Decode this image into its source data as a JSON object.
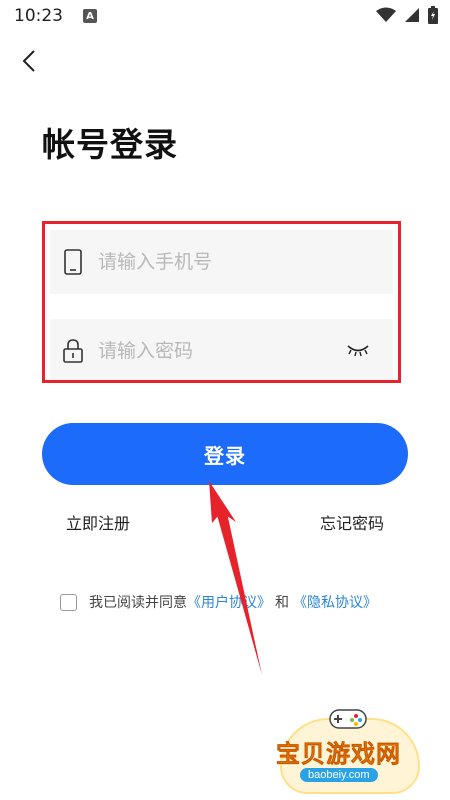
{
  "status_bar": {
    "time": "10:23",
    "notification_letter": "A"
  },
  "title": "帐号登录",
  "phone_field": {
    "placeholder": "请输入手机号",
    "value": ""
  },
  "password_field": {
    "placeholder": "请输入密码",
    "value": ""
  },
  "login_button": "登录",
  "links": {
    "register": "立即注册",
    "forgot": "忘记密码"
  },
  "agreement": {
    "prefix": "我已阅读并同意",
    "user_agreement": "《用户协议》",
    "and": "和",
    "privacy_agreement": "《隐私协议》"
  },
  "watermark": {
    "brand": "宝贝游戏网",
    "url": "baobeiy.com"
  },
  "colors": {
    "primary": "#1d6bfb",
    "highlight": "#e6232b",
    "link": "#2b86d8",
    "field_bg": "#f6f6f6"
  }
}
